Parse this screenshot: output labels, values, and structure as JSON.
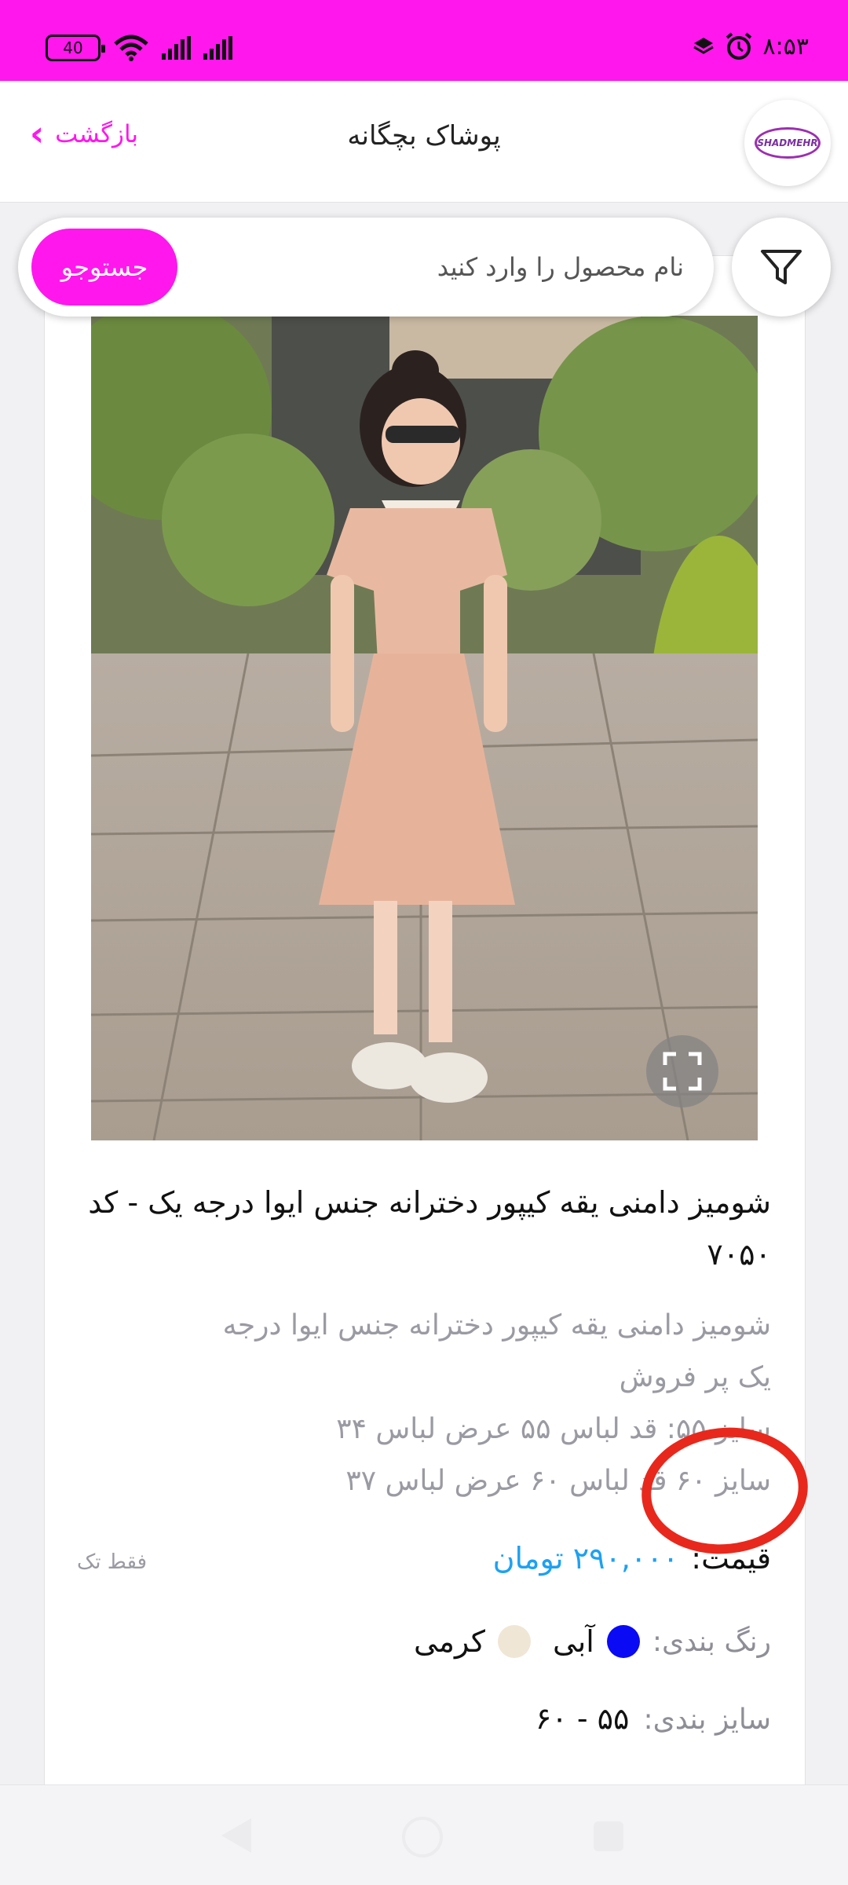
{
  "status_bar": {
    "time": "۸:۵۳",
    "battery": "40",
    "icons": [
      "alarm-icon",
      "layers-icon",
      "wifi-icon",
      "signal-icon"
    ]
  },
  "header": {
    "title": "پوشاک بچگانه",
    "back_label": "بازگشت",
    "logo_text": "SHADMEHR"
  },
  "search": {
    "placeholder": "نام محصول را وارد کنید",
    "button_label": "جستوجو"
  },
  "product": {
    "title": "شومیز دامنی یقه کیپور دخترانه جنس ایوا درجه یک - کد ۷۰۵۰",
    "description_lines": [
      "شومیز دامنی یقه کیپور دخترانه جنس ایوا درجه",
      "یک پر فروش",
      "سایز ۵۵: قد لباس ۵۵ عرض لباس ۳۴",
      "سایز ۶۰ قد لباس ۶۰ عرض لباس ۳۷"
    ],
    "price_label": "قیمت:",
    "price_value": "۲۹۰,۰۰۰ تومان",
    "single_note": "فقط تک",
    "color_label": "رنگ بندی:",
    "colors": [
      {
        "name": "آبی",
        "hex": "#0a0af5"
      },
      {
        "name": "کرمی",
        "hex": "#f0e6d6"
      }
    ],
    "size_label": "سایز بندی:",
    "size_value": "۵۵ - ۶۰"
  },
  "colors": {
    "accent": "#ff17ee",
    "price": "#1da1f2",
    "annotation": "#e8281c"
  }
}
